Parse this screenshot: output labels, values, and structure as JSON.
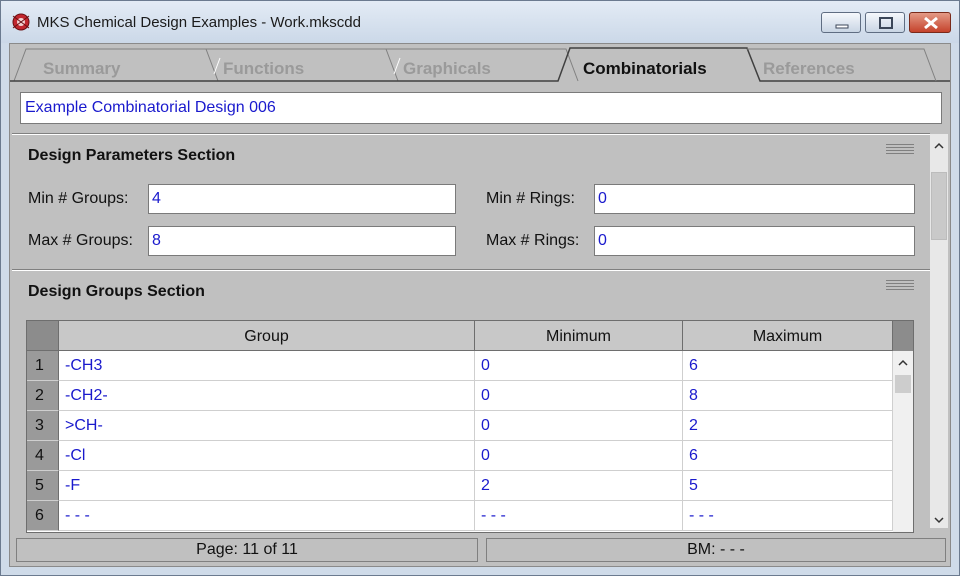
{
  "window": {
    "title": "MKS Chemical Design Examples - Work.mkscdd"
  },
  "tabs": [
    {
      "label": "Summary",
      "active": false
    },
    {
      "label": "Functions",
      "active": false
    },
    {
      "label": "Graphicals",
      "active": false
    },
    {
      "label": "Combinatorials",
      "active": true
    },
    {
      "label": "References",
      "active": false
    }
  ],
  "design_name": "Example Combinatorial Design 006",
  "parameters": {
    "title": "Design Parameters Section",
    "min_groups_label": "Min # Groups:",
    "min_groups_value": "4",
    "max_groups_label": "Max # Groups:",
    "max_groups_value": "8",
    "min_rings_label": "Min # Rings:",
    "min_rings_value": "0",
    "max_rings_label": "Max # Rings:",
    "max_rings_value": "0"
  },
  "groups": {
    "title": "Design Groups Section",
    "columns": [
      "Group",
      "Minimum",
      "Maximum"
    ],
    "rows": [
      {
        "num": "1",
        "group": "-CH3",
        "min": "0",
        "max": "6"
      },
      {
        "num": "2",
        "group": "-CH2-",
        "min": "0",
        "max": "8"
      },
      {
        "num": "3",
        "group": ">CH-",
        "min": "0",
        "max": "2"
      },
      {
        "num": "4",
        "group": "-Cl",
        "min": "0",
        "max": "6"
      },
      {
        "num": "5",
        "group": "-F",
        "min": "2",
        "max": "5"
      },
      {
        "num": "6",
        "group": "- - -",
        "min": "- - -",
        "max": "- - -"
      }
    ]
  },
  "status": {
    "page": "Page: 11 of 11",
    "bookmark": "BM: - - -"
  },
  "colors": {
    "value_text": "#1a1acd",
    "panel": "#c0c0c0",
    "inactive_tab": "#9a9a9a",
    "close_button": "#c5432c"
  }
}
